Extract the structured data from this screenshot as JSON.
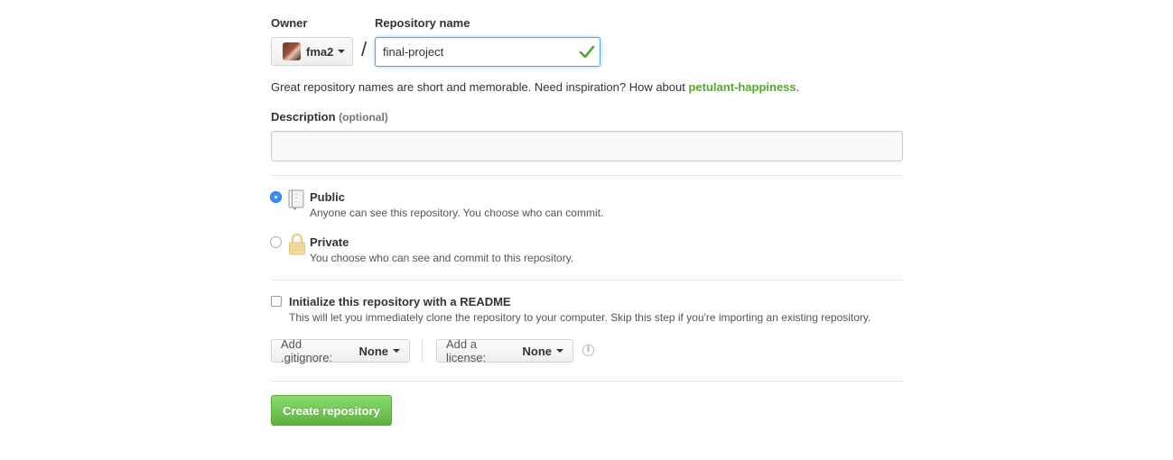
{
  "owner": {
    "label": "Owner",
    "username": "fma2"
  },
  "repo_name": {
    "label": "Repository name",
    "separator": "/",
    "value": "final-project"
  },
  "hint": {
    "text": "Great repository names are short and memorable. Need inspiration? How about ",
    "suggestion": "petulant-happiness",
    "end": "."
  },
  "description": {
    "label": "Description",
    "optional": "(optional)",
    "value": ""
  },
  "visibility": {
    "public": {
      "title": "Public",
      "desc": "Anyone can see this repository. You choose who can commit.",
      "selected": true
    },
    "private": {
      "title": "Private",
      "desc": "You choose who can see and commit to this repository.",
      "selected": false
    }
  },
  "readme": {
    "title": "Initialize this repository with a README",
    "desc": "This will let you immediately clone the repository to your computer. Skip this step if you're importing an existing repository.",
    "checked": false
  },
  "gitignore": {
    "label": "Add .gitignore:",
    "value": "None"
  },
  "license": {
    "label": "Add a license:",
    "value": "None"
  },
  "submit": {
    "label": "Create repository"
  },
  "colors": {
    "accent_blue": "#3f8ef7",
    "success_green": "#55a532",
    "button_green": "#60b044"
  },
  "icons": {
    "check": "check-icon",
    "repo": "repo-icon",
    "lock": "lock-icon",
    "info": "info-icon",
    "caret": "caret-down-icon"
  }
}
